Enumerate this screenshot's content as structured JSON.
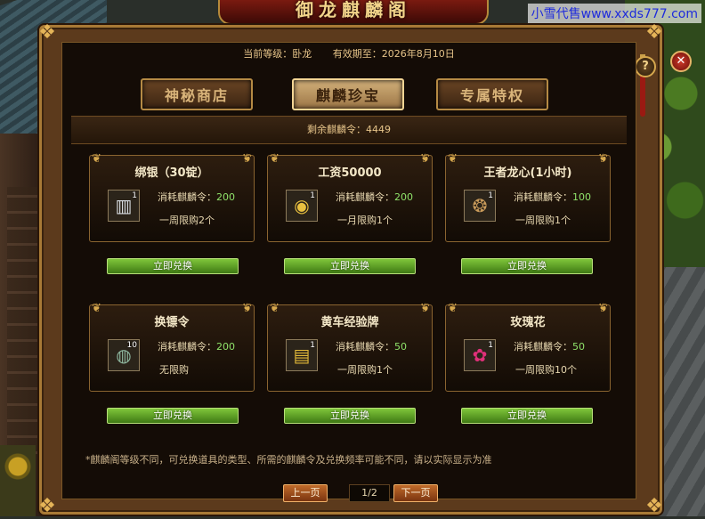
{
  "window_title": "御龙麒麟阁",
  "watermark": "小雪代售www.xxds777.com",
  "info": {
    "level_label": "当前等级：卧龙",
    "valid_label": "有效期至：2026年8月10日"
  },
  "tabs": [
    {
      "label": "神秘商店",
      "active": false
    },
    {
      "label": "麒麟珍宝",
      "active": true
    },
    {
      "label": "专属特权",
      "active": false
    }
  ],
  "remaining": "剩余麒麟令：4449",
  "cost_label": "消耗麒麟令：",
  "exchange_label": "立即兑换",
  "items": [
    {
      "title": "绑银（30锭）",
      "icon": "silver-ingot-icon",
      "glyph": "▥",
      "count": "1",
      "cost": "200",
      "limit": "一周限购2个"
    },
    {
      "title": "工资50000",
      "icon": "gold-ingot-icon",
      "glyph": "◉",
      "count": "1",
      "cost": "200",
      "limit": "一月限购1个"
    },
    {
      "title": "王者龙心(1小时)",
      "icon": "dragon-heart-icon",
      "glyph": "❂",
      "count": "1",
      "cost": "100",
      "limit": "一周限购1个"
    },
    {
      "title": "换镖令",
      "icon": "escort-token-icon",
      "glyph": "◍",
      "count": "10",
      "cost": "200",
      "limit": "无限购"
    },
    {
      "title": "黄车经验牌",
      "icon": "cart-exp-card-icon",
      "glyph": "▤",
      "count": "1",
      "cost": "50",
      "limit": "一周限购1个"
    },
    {
      "title": "玫瑰花",
      "icon": "rose-icon",
      "glyph": "✿",
      "count": "1",
      "cost": "50",
      "limit": "一周限购10个"
    }
  ],
  "note": "*麒麟阁等级不同，可兑换道具的类型、所需的麒麟令及兑换频率可能不同，请以实际显示为准",
  "pager": {
    "prev": "上一页",
    "page": "1/2",
    "next": "下一页"
  },
  "buttons": {
    "help": "?",
    "close": "✕"
  }
}
